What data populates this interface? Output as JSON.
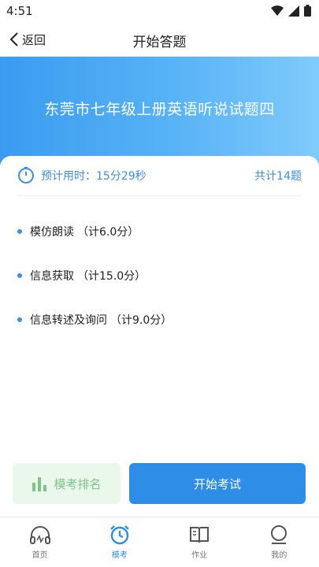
{
  "status": {
    "time": "4:51"
  },
  "nav": {
    "back_label": "返回",
    "title": "开始答题"
  },
  "hero": {
    "title": "东莞市七年级上册英语听说试题四"
  },
  "summary": {
    "time_label": "预计用时：15分29秒",
    "total": "共计14题"
  },
  "sections": [
    {
      "name": "模仿朗读",
      "score": "（计6.0分）"
    },
    {
      "name": "信息获取",
      "score": "（计15.0分）"
    },
    {
      "name": "信息转述及询问",
      "score": "（计9.0分）"
    }
  ],
  "actions": {
    "rank_label": "模考排名",
    "start_label": "开始考试"
  },
  "tabs": [
    {
      "label": "首页",
      "icon": "headphones-icon"
    },
    {
      "label": "模考",
      "icon": "alarm-clock-icon"
    },
    {
      "label": "作业",
      "icon": "book-icon"
    },
    {
      "label": "我的",
      "icon": "user-icon"
    }
  ],
  "colors": {
    "primary": "#2e8de6",
    "rank_bg": "#eaf8ec",
    "rank_fg": "#7cc487"
  }
}
